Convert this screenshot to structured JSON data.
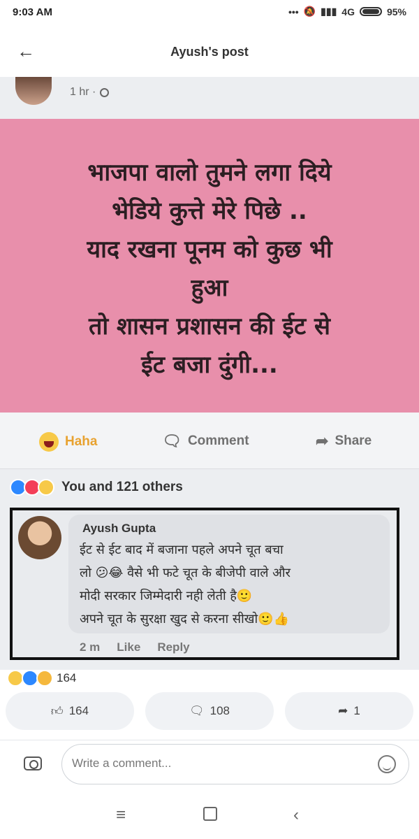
{
  "status_bar": {
    "time": "9:03 AM",
    "network": "4G",
    "battery": "95%"
  },
  "header": {
    "title": "Ayush's post"
  },
  "original_post": {
    "time": "1 hr ·",
    "text": "भाजपा वालो तुमने लगा दिये\nभेडिये कुत्ते मेरे पिछे ..\nयाद रखना पूनम को कुछ भी\nहुआ\nतो शासन प्रशासन की ईट से\nईट बजा दुंगी...",
    "background_color": "#e88fab",
    "actions": {
      "reaction": "Haha",
      "comment": "Comment",
      "share": "Share"
    },
    "reactions_summary": "You and 121 others"
  },
  "embedded_comment": {
    "author": "Ayush Gupta",
    "text": "ईट से ईट बाद में बजाना पहले अपने चूत बचा\nलो 😕😂 वैसे भी फटे चूत के बीजेपी वाले और\nमोदी सरकार जिम्मेदारी नही लेती है🙂\nअपने चूत के सुरक्षा खुद से करना सीखो🙂👍",
    "time": "2 m",
    "like": "Like",
    "reply": "Reply"
  },
  "post_footer": {
    "reaction_count": "164",
    "like_count": "164",
    "comment_count": "108",
    "share_count": "1"
  },
  "comment_input": {
    "placeholder": "Write a comment..."
  }
}
